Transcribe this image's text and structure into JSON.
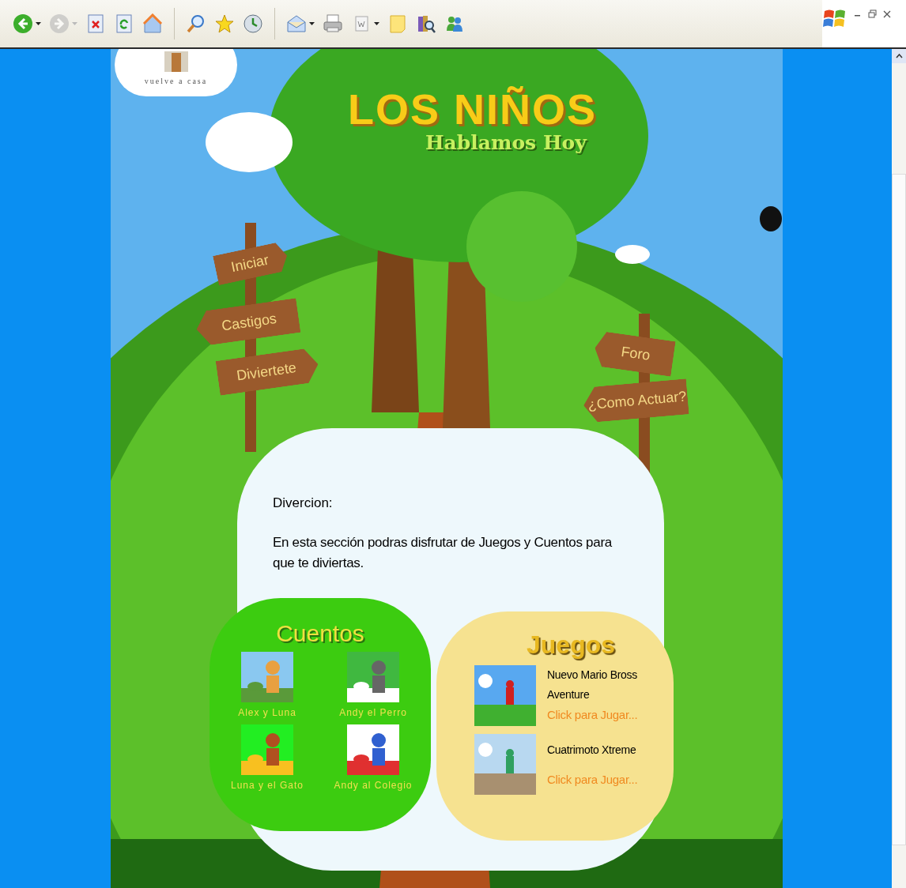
{
  "toolbar": {
    "buttons": [
      {
        "kind": "back",
        "disabled": false,
        "dropdown": true
      },
      {
        "kind": "forward",
        "disabled": true,
        "dropdown": true
      },
      {
        "kind": "stop",
        "disabled": false,
        "dropdown": false
      },
      {
        "kind": "refresh",
        "disabled": false,
        "dropdown": false
      },
      {
        "kind": "home",
        "disabled": false,
        "dropdown": false
      },
      {
        "kind": "search",
        "disabled": false,
        "dropdown": false
      },
      {
        "kind": "favorites",
        "disabled": false,
        "dropdown": false
      },
      {
        "kind": "history",
        "disabled": false,
        "dropdown": false
      },
      {
        "kind": "mail",
        "disabled": false,
        "dropdown": true
      },
      {
        "kind": "print",
        "disabled": false,
        "dropdown": false
      },
      {
        "kind": "edit",
        "disabled": false,
        "dropdown": true
      },
      {
        "kind": "note",
        "disabled": false,
        "dropdown": false
      },
      {
        "kind": "research",
        "disabled": false,
        "dropdown": false
      },
      {
        "kind": "messenger",
        "disabled": false,
        "dropdown": false
      }
    ]
  },
  "home_link": {
    "label": "vuelve a casa"
  },
  "logo": {
    "title": "LOS NIÑOS",
    "subtitle": "Hablamos Hoy"
  },
  "signs_left": [
    "Iniciar",
    "Castigos",
    "Diviertete"
  ],
  "signs_right": [
    "Foro",
    "¿Como Actuar?"
  ],
  "content": {
    "heading": "Divercion:",
    "text": "En esta sección podras disfrutar de Juegos y Cuentos para que te diviertas."
  },
  "cuentos": {
    "title": "Cuentos",
    "stories": [
      {
        "title": "Alex y Luna"
      },
      {
        "title": "Andy el Perro"
      },
      {
        "title": "Luna y el Gato"
      },
      {
        "title": "Andy al Colegio"
      }
    ]
  },
  "juegos": {
    "title": "Juegos",
    "games": [
      {
        "title": "Nuevo Mario Bross Aventure",
        "link": "Click para Jugar..."
      },
      {
        "title": "Cuatrimoto Xtreme",
        "link": "Click para Jugar..."
      }
    ]
  }
}
